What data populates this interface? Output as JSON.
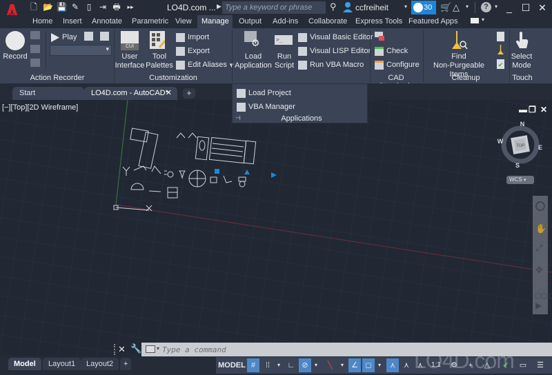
{
  "app": {
    "title": "LO4D.com ...",
    "brand_color": "#e0252b",
    "accent_color": "#1e86d8"
  },
  "quick_access": [
    "new-file",
    "open-file",
    "save",
    "save-as",
    "open-from-web",
    "share",
    "plot",
    "more"
  ],
  "search": {
    "placeholder": "Type a keyword or phrase"
  },
  "user": {
    "name": "ccfreiheit"
  },
  "trial": {
    "days": "30"
  },
  "help": {
    "glyph": "?"
  },
  "window_controls": {
    "minimize": "_",
    "maximize": "☐",
    "close": "✕"
  },
  "ribbon_tabs": [
    {
      "label": "Home"
    },
    {
      "label": "Insert"
    },
    {
      "label": "Annotate"
    },
    {
      "label": "Parametric"
    },
    {
      "label": "View"
    },
    {
      "label": "Manage",
      "active": true
    },
    {
      "label": "Output"
    },
    {
      "label": "Add-ins"
    },
    {
      "label": "Collaborate"
    },
    {
      "label": "Express Tools"
    },
    {
      "label": "Featured Apps"
    }
  ],
  "ribbon": {
    "action_recorder": {
      "title": "Action Recorder",
      "record": "Record",
      "play": "Play"
    },
    "customization": {
      "title": "Customization",
      "user_interface": [
        "User",
        "Interface"
      ],
      "tool_palettes": [
        "Tool",
        "Palettes"
      ],
      "import": "Import",
      "export": "Export",
      "edit_aliases": "Edit Aliases"
    },
    "applications": {
      "title": "Applications",
      "load_application": [
        "Load",
        "Application"
      ],
      "run_script": [
        "Run",
        "Script"
      ],
      "visual_basic_editor": "Visual Basic Editor",
      "visual_lisp_editor": "Visual LISP Editor",
      "run_vba_macro": "Run VBA Macro",
      "load_project": "Load Project",
      "vba_manager": "VBA Manager"
    },
    "cad_standards": {
      "title": "CAD Standards",
      "check": "Check",
      "configure": "Configure"
    },
    "cleanup": {
      "title": "Cleanup",
      "find": [
        "Find",
        "Non-Purgeable Items"
      ]
    },
    "touch": {
      "title": "Touch",
      "select_mode": [
        "Select",
        "Mode"
      ]
    }
  },
  "doc_tabs": [
    {
      "label": "Start"
    },
    {
      "label": "LO4D.com - AutoCAD*",
      "active": true
    }
  ],
  "viewport": {
    "label": "[−][Top][2D Wireframe]",
    "viewcube": {
      "top": "TOP",
      "n": "N",
      "s": "S",
      "e": "E",
      "w": "W",
      "ucs": "WCS"
    }
  },
  "command": {
    "placeholder": "Type a command"
  },
  "layout_tabs": [
    {
      "label": "Model",
      "active": true
    },
    {
      "label": "Layout1"
    },
    {
      "label": "Layout2"
    }
  ],
  "status": {
    "model": "MODEL",
    "scale": "1:1"
  },
  "watermark": "LO4D.com"
}
